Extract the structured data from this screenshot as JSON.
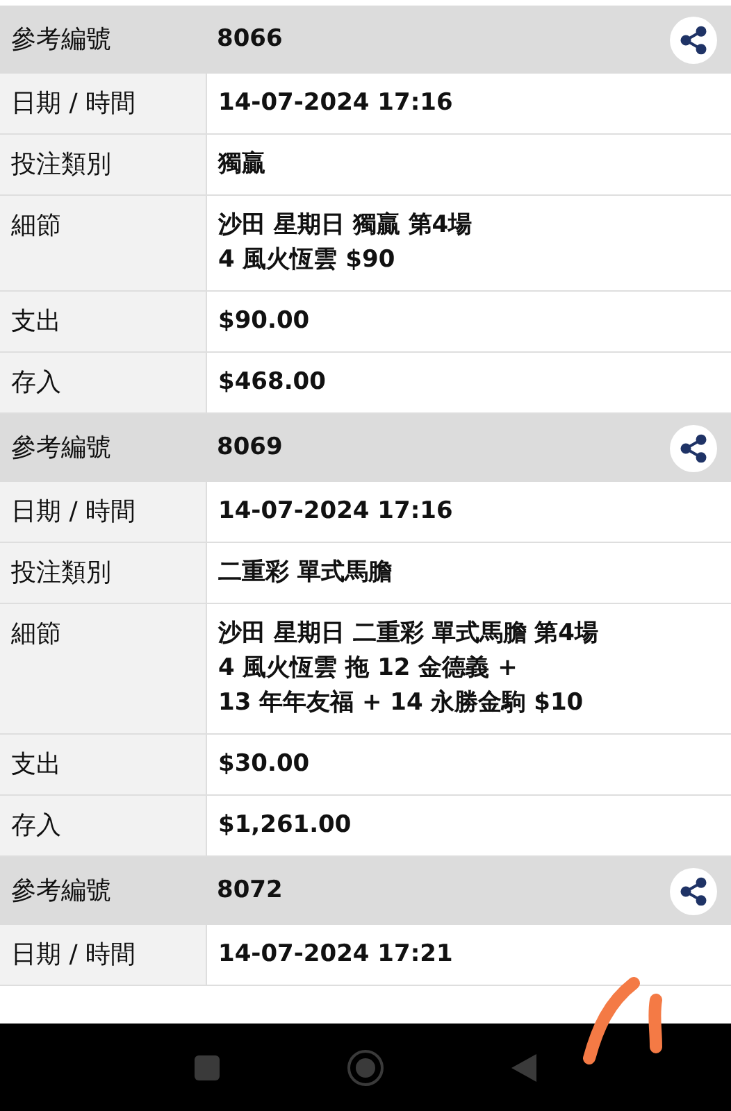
{
  "records": [
    {
      "ref_label": "參考編號",
      "ref": "8066",
      "fields": [
        {
          "label": "日期 / 時間",
          "lines": [
            "14-07-2024 17:16"
          ]
        },
        {
          "label": "投注類別",
          "lines": [
            "獨贏"
          ]
        },
        {
          "label": "細節",
          "lines": [
            "沙田 星期日 獨贏 第4場",
            "4 風火恆雲 $90"
          ]
        },
        {
          "label": "支出",
          "lines": [
            "$90.00"
          ]
        },
        {
          "label": "存入",
          "lines": [
            "$468.00"
          ]
        }
      ]
    },
    {
      "ref_label": "參考編號",
      "ref": "8069",
      "fields": [
        {
          "label": "日期 / 時間",
          "lines": [
            "14-07-2024 17:16"
          ]
        },
        {
          "label": "投注類別",
          "lines": [
            "二重彩 單式馬膽"
          ]
        },
        {
          "label": "細節",
          "lines": [
            "沙田 星期日 二重彩 單式馬膽 第4場",
            "4 風火恆雲 拖 12 金德義 +",
            "13 年年友福 + 14 永勝金駒 $10"
          ]
        },
        {
          "label": "支出",
          "lines": [
            "$30.00"
          ]
        },
        {
          "label": "存入",
          "lines": [
            "$1,261.00"
          ]
        }
      ]
    },
    {
      "ref_label": "參考編號",
      "ref": "8072",
      "fields": [
        {
          "label": "日期 / 時間",
          "lines": [
            "14-07-2024 17:21"
          ]
        }
      ]
    }
  ]
}
